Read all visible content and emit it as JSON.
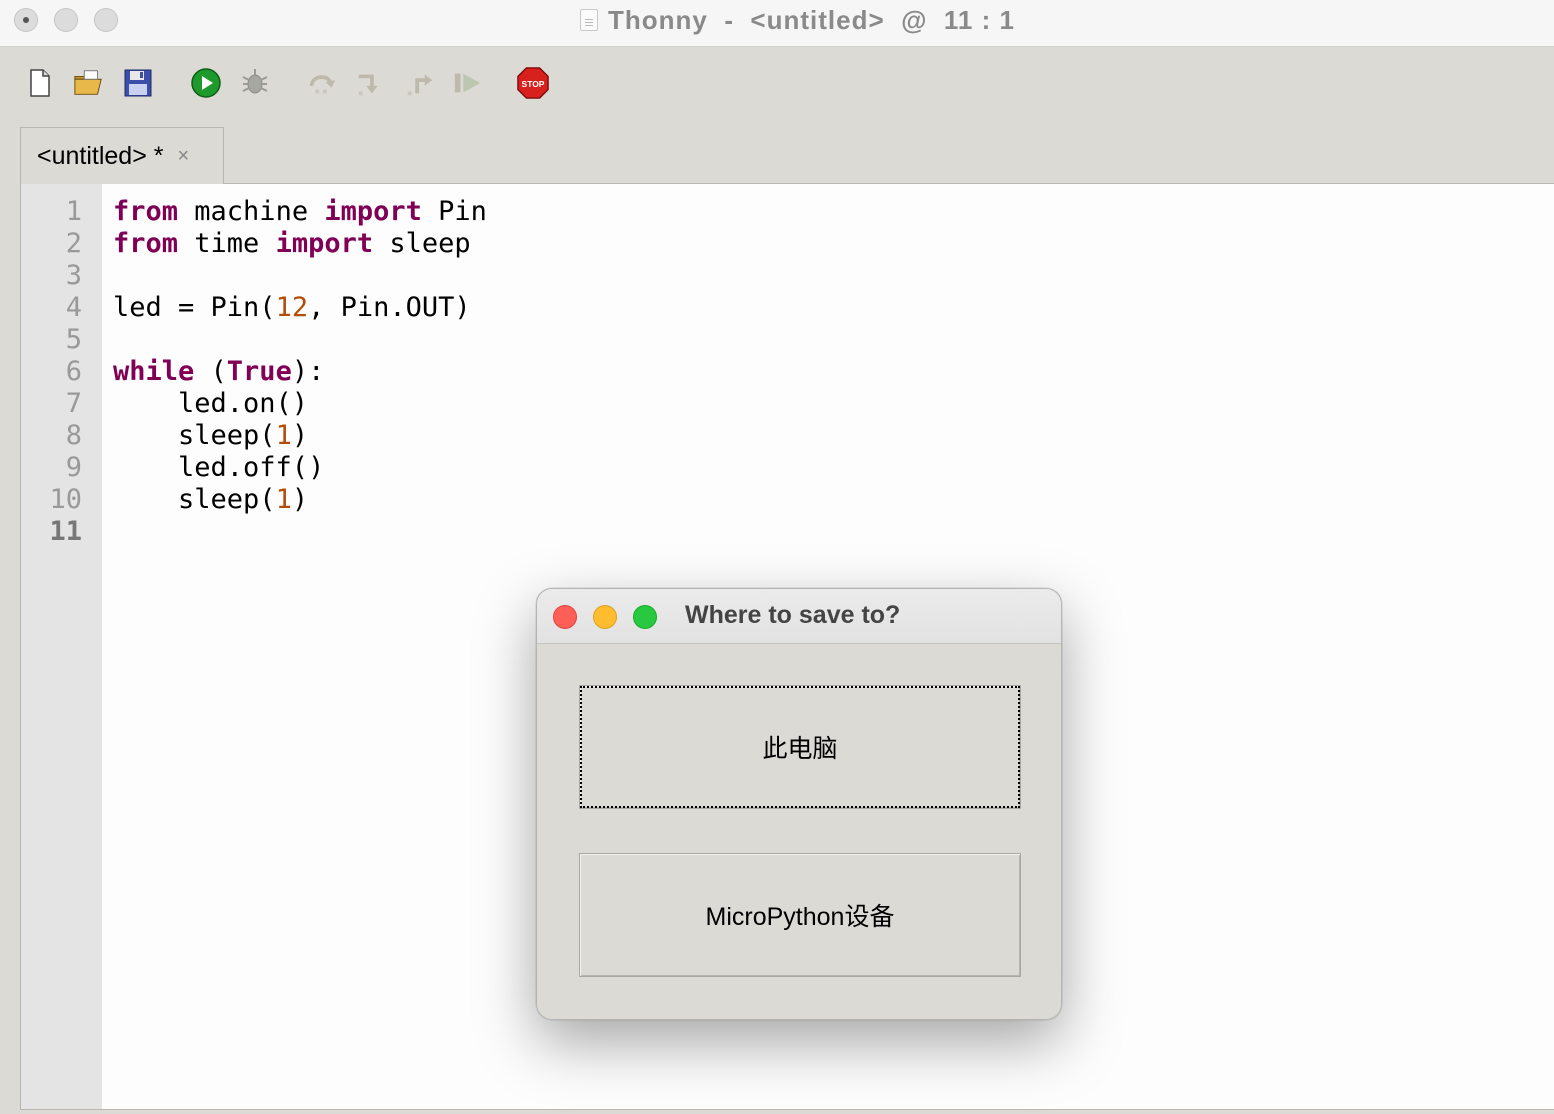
{
  "window": {
    "title": "Thonny  -  <untitled>  @  11 : 1"
  },
  "toolbar": {
    "buttons": [
      {
        "name": "new-file-icon",
        "label": "New"
      },
      {
        "name": "open-file-icon",
        "label": "Open"
      },
      {
        "name": "save-file-icon",
        "label": "Save"
      },
      {
        "name": "run-icon",
        "label": "Run"
      },
      {
        "name": "debug-icon",
        "label": "Debug"
      },
      {
        "name": "step-over-icon",
        "label": "Step over"
      },
      {
        "name": "step-into-icon",
        "label": "Step into"
      },
      {
        "name": "step-out-icon",
        "label": "Step out"
      },
      {
        "name": "resume-icon",
        "label": "Resume"
      },
      {
        "name": "stop-icon",
        "label": "STOP"
      }
    ]
  },
  "editor": {
    "tab_label": "<untitled> *",
    "tab_close": "×",
    "line_numbers": [
      "1",
      "2",
      "3",
      "4",
      "5",
      "6",
      "7",
      "8",
      "9",
      "10",
      "11"
    ],
    "current_line": "11",
    "code_lines": [
      [
        {
          "t": "from",
          "c": "kw"
        },
        {
          "t": " machine "
        },
        {
          "t": "import",
          "c": "kw"
        },
        {
          "t": " Pin"
        }
      ],
      [
        {
          "t": "from",
          "c": "kw"
        },
        {
          "t": " time "
        },
        {
          "t": "import",
          "c": "kw"
        },
        {
          "t": " sleep"
        }
      ],
      [],
      [
        {
          "t": "led = Pin("
        },
        {
          "t": "12",
          "c": "num"
        },
        {
          "t": ", Pin.OUT)"
        }
      ],
      [],
      [
        {
          "t": "while",
          "c": "kw"
        },
        {
          "t": " ("
        },
        {
          "t": "True",
          "c": "kw"
        },
        {
          "t": "):"
        }
      ],
      [
        {
          "t": "    led.on()"
        }
      ],
      [
        {
          "t": "    sleep("
        },
        {
          "t": "1",
          "c": "num"
        },
        {
          "t": ")"
        }
      ],
      [
        {
          "t": "    led.off()"
        }
      ],
      [
        {
          "t": "    sleep("
        },
        {
          "t": "1",
          "c": "num"
        },
        {
          "t": ")"
        }
      ],
      []
    ]
  },
  "dialog": {
    "title": "Where to save to?",
    "option_computer": "此电脑",
    "option_device": "MicroPython设备"
  },
  "colors": {
    "keyword": "#7f0055",
    "number": "#b24d0a",
    "traffic_red": "#ff5f57",
    "traffic_yellow": "#febc2e",
    "traffic_green": "#28c840"
  }
}
